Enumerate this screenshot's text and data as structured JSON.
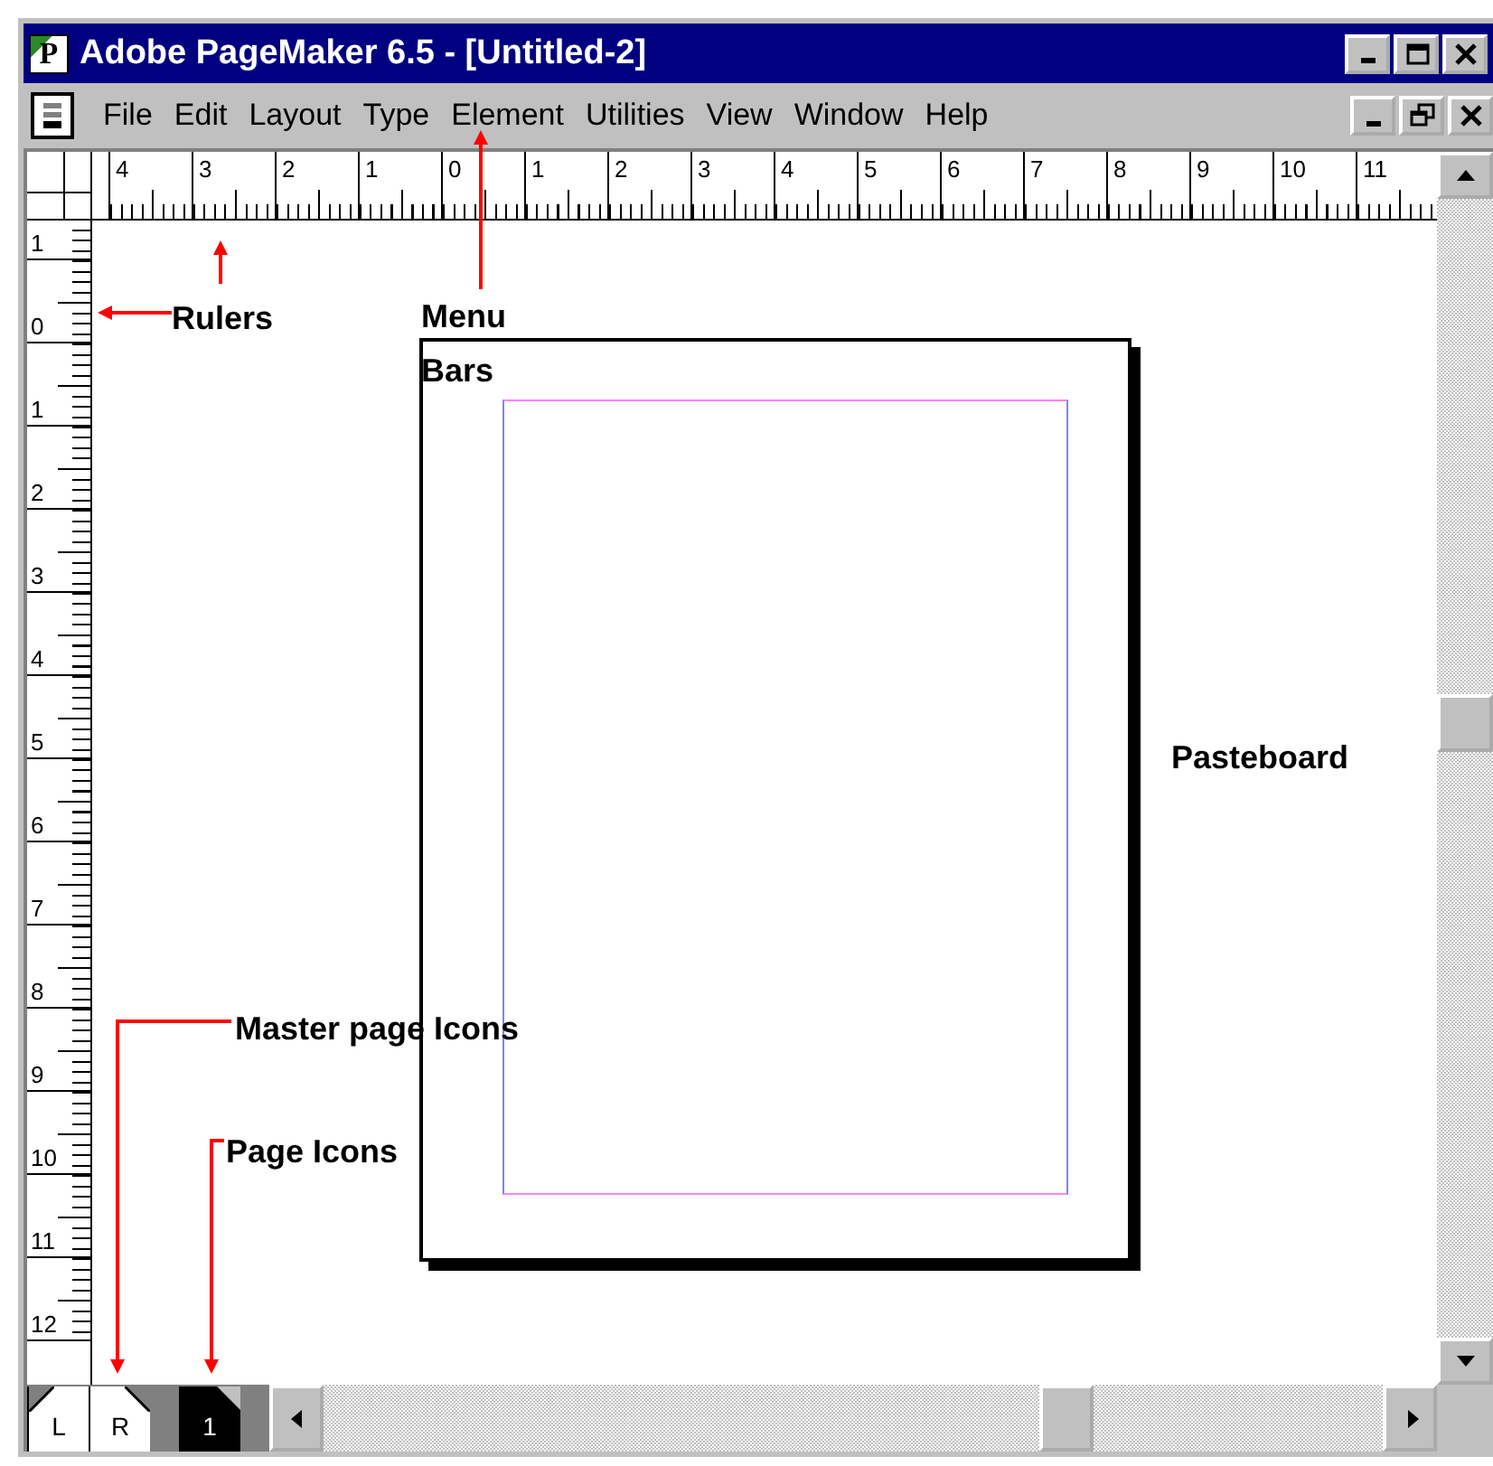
{
  "window": {
    "app_icon": "P",
    "title": "Adobe PageMaker 6.5 - [Untitled-2]"
  },
  "menu_bar": {
    "items": [
      "File",
      "Edit",
      "Layout",
      "Type",
      "Element",
      "Utilities",
      "View",
      "Window",
      "Help"
    ]
  },
  "rulers": {
    "horizontal": [
      "4",
      "3",
      "2",
      "1",
      "0",
      "1",
      "2",
      "3",
      "4",
      "5",
      "6",
      "7",
      "8",
      "9",
      "10",
      "11"
    ],
    "vertical": [
      "1",
      "0",
      "1",
      "2",
      "3",
      "4",
      "5",
      "6",
      "7",
      "8",
      "9",
      "10",
      "11",
      "12"
    ]
  },
  "page_icons": [
    {
      "label": "L",
      "kind": "left-master",
      "selected": false
    },
    {
      "label": "R",
      "kind": "right-master",
      "selected": false
    },
    {
      "label": "1",
      "kind": "page",
      "selected": true
    }
  ],
  "annotations": [
    {
      "text": "Rulers"
    },
    {
      "text": "Menu Bars"
    },
    {
      "text": "Pasteboard"
    },
    {
      "text": "Master page Icons"
    },
    {
      "text": "Page Icons"
    }
  ]
}
